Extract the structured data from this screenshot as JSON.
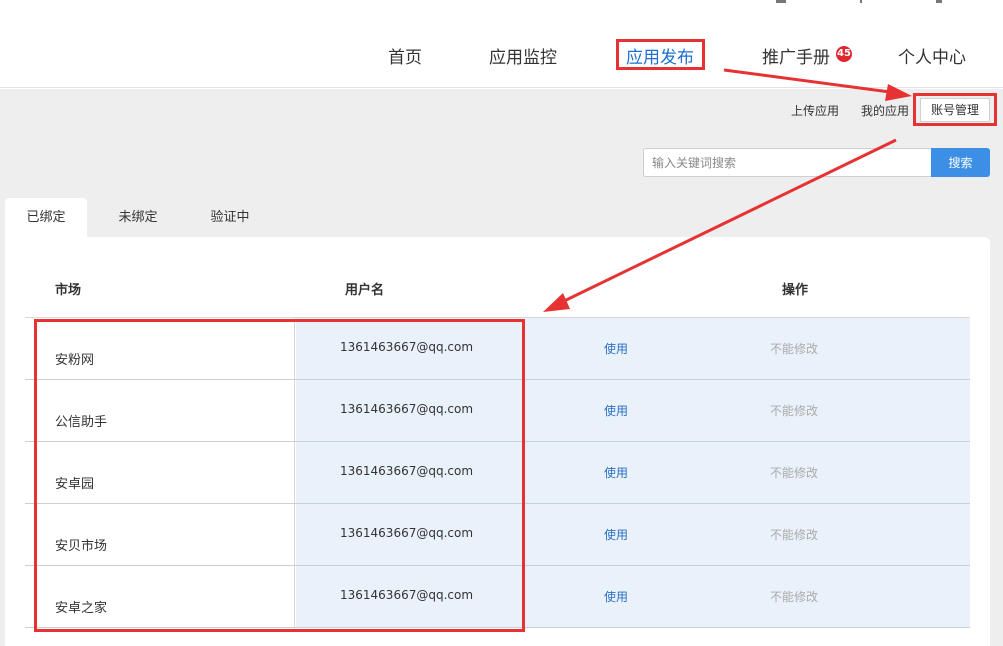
{
  "nav": {
    "items": [
      {
        "label": "首页",
        "active": false
      },
      {
        "label": "应用监控",
        "active": false
      },
      {
        "label": "应用发布",
        "active": true
      },
      {
        "label": "推广手册",
        "active": false,
        "badge": "45"
      },
      {
        "label": "个人中心",
        "active": false
      }
    ]
  },
  "subnav": {
    "upload": "上传应用",
    "my_apps": "我的应用",
    "account_manage": "账号管理"
  },
  "search": {
    "placeholder": "输入关键词搜索",
    "button": "搜索"
  },
  "tabs": [
    "已绑定",
    "未绑定",
    "验证中"
  ],
  "table": {
    "headers": {
      "market": "市场",
      "username": "用户名",
      "action": "操作"
    },
    "rows": [
      {
        "market": "安粉网",
        "username": "1361463667@qq.com",
        "use": "使用",
        "status": "不能修改"
      },
      {
        "market": "公信助手",
        "username": "1361463667@qq.com",
        "use": "使用",
        "status": "不能修改"
      },
      {
        "market": "安卓园",
        "username": "1361463667@qq.com",
        "use": "使用",
        "status": "不能修改"
      },
      {
        "market": "安贝市场",
        "username": "1361463667@qq.com",
        "use": "使用",
        "status": "不能修改"
      },
      {
        "market": "安卓之家",
        "username": "1361463667@qq.com",
        "use": "使用",
        "status": "不能修改"
      }
    ]
  },
  "colors": {
    "accent": "#1e6fd0",
    "annotation_red": "#e63232",
    "search_button": "#3d8fe6",
    "badge": "#e0262f",
    "row_highlight": "#e9f2fb"
  }
}
